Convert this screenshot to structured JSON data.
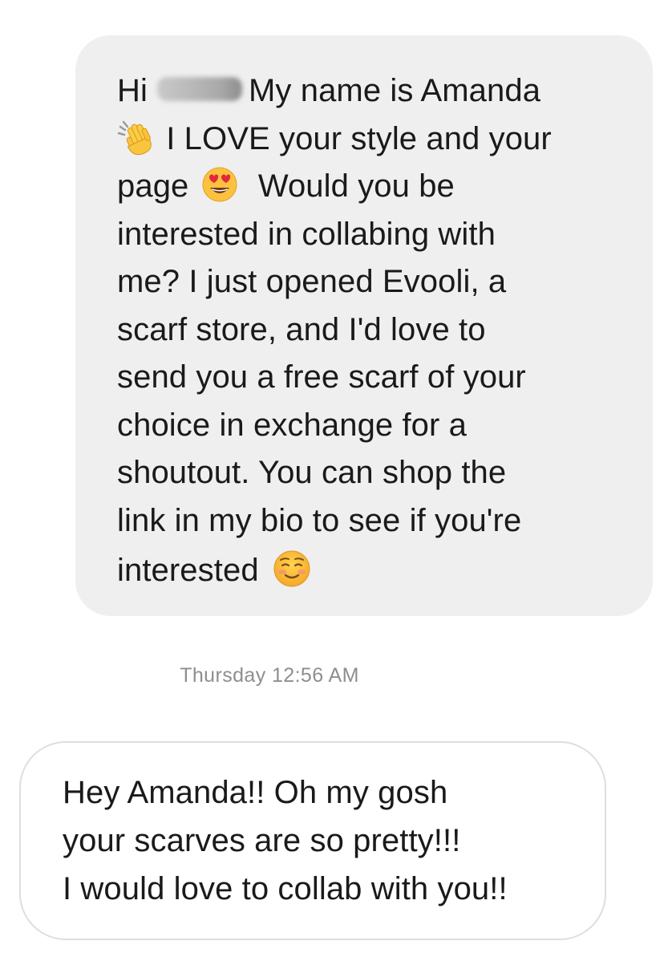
{
  "conversation": {
    "received_message": {
      "line1_greeting": "Hi",
      "line1_rest": "My name is Amanda",
      "line2_emoji": "waving-hand-emoji",
      "line2_text": "I LOVE your style and your",
      "line3_text": "page",
      "line3_emoji": "heart-eyes-emoji",
      "line3_rest": "Would you be",
      "line4": "interested in collabing with",
      "line5": "me? I just opened Evooli, a",
      "line6": "scarf store, and I'd love to",
      "line7": "send you a free scarf of your",
      "line8": "choice in exchange for a",
      "line9": "shoutout. You can shop the",
      "line10": "link in my bio to see if you're",
      "line11": "interested",
      "line11_emoji": "smiling-blush-emoji"
    },
    "timestamp": "Thursday 12:56 AM",
    "sent_message": {
      "line1": "Hey Amanda!! Oh my gosh",
      "line2": "your scarves are so pretty!!!",
      "line3": "I would love to collab with you!!"
    }
  },
  "colors": {
    "received_bubble": "#efefef",
    "sent_bubble_border": "#dedede",
    "timestamp_text": "#8e8e8e",
    "message_text": "#1a1a1a"
  }
}
